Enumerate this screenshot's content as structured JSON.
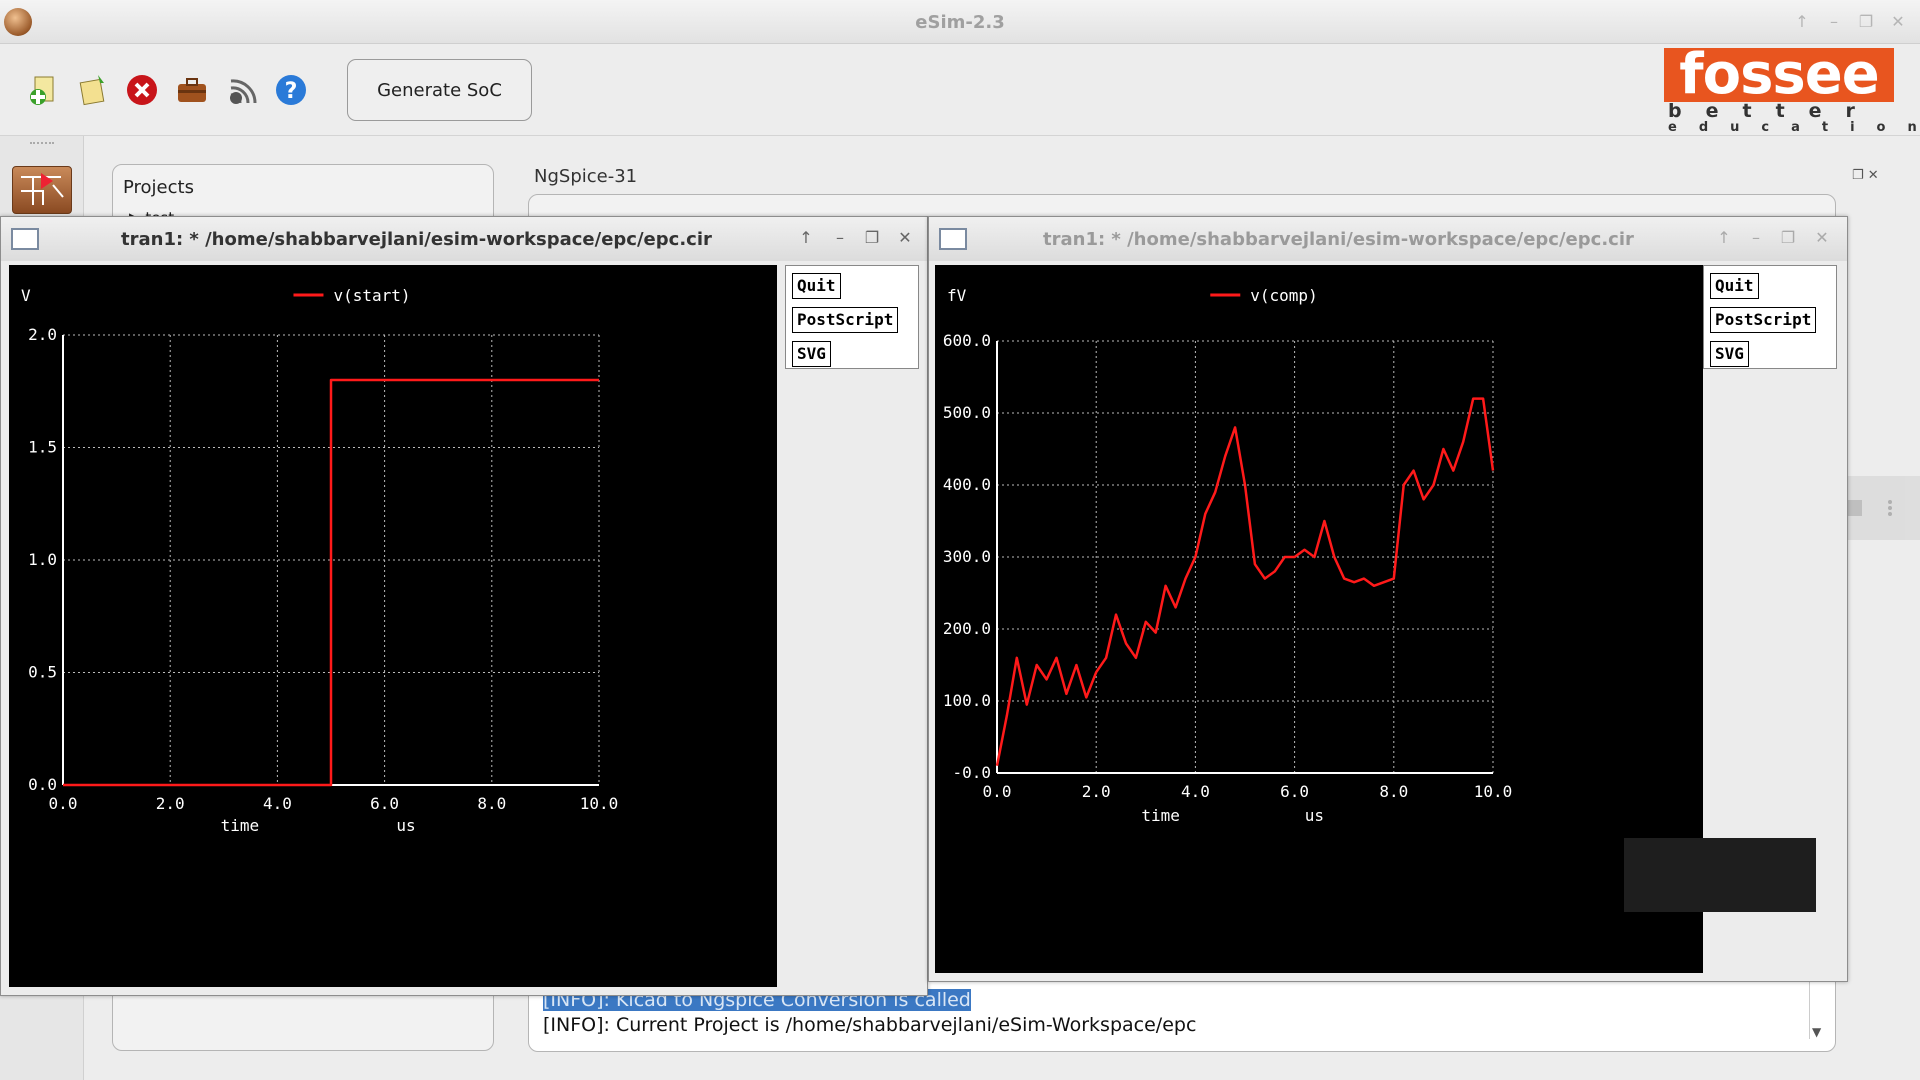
{
  "window": {
    "title": "eSim-2.3",
    "controls": [
      "↑",
      "–",
      "❐",
      "✕"
    ]
  },
  "toolbar": {
    "buttons": [
      {
        "name": "new-project",
        "icon": "new-project-icon"
      },
      {
        "name": "open-project",
        "icon": "open-project-icon"
      },
      {
        "name": "close-project",
        "icon": "close-icon"
      },
      {
        "name": "toolbox",
        "icon": "briefcase-icon"
      },
      {
        "name": "wifi",
        "icon": "wifi-icon"
      },
      {
        "name": "help",
        "icon": "help-icon"
      }
    ],
    "generate_soc_label": "Generate SoC",
    "logo": {
      "line1": "fossee",
      "line2": "better",
      "line3": "education"
    }
  },
  "projects_panel": {
    "title": "Projects",
    "tree_item": "test"
  },
  "ngspice": {
    "title": "NgSpice-31"
  },
  "console": {
    "lines": [
      "[INFO]: Kicad to Ngspice Conversion is called",
      "[INFO]: Current Project is /home/shabbarvejlani/eSim-Workspace/epc"
    ]
  },
  "plot_windows": [
    {
      "title": "tran1: * /home/shabbarvejlani/esim-workspace/epc/epc.cir",
      "active": true,
      "buttons": {
        "quit": "Quit",
        "postscript": "PostScript",
        "svg": "SVG"
      },
      "chart_data": {
        "type": "line",
        "ylabel_unit": "V",
        "xlabel": "time",
        "xunit": "us",
        "xlim": [
          0,
          10
        ],
        "ylim": [
          0,
          2
        ],
        "x_ticks": [
          "0.0",
          "2.0",
          "4.0",
          "6.0",
          "8.0",
          "10.0"
        ],
        "y_ticks": [
          "0.0",
          "0.5",
          "1.0",
          "1.5",
          "2.0"
        ],
        "series": [
          {
            "name": "v(start)",
            "color": "#ff1a1a",
            "x": [
              0,
              5,
              5,
              10
            ],
            "y": [
              0,
              0,
              1.8,
              1.8
            ]
          }
        ],
        "background": "#000000",
        "grid": true
      }
    },
    {
      "title": "tran1: * /home/shabbarvejlani/esim-workspace/epc/epc.cir",
      "active": false,
      "buttons": {
        "quit": "Quit",
        "postscript": "PostScript",
        "svg": "SVG"
      },
      "chart_data": {
        "type": "line",
        "ylabel_unit": "fV",
        "xlabel": "time",
        "xunit": "us",
        "xlim": [
          0,
          10
        ],
        "ylim": [
          0,
          600
        ],
        "x_ticks": [
          "0.0",
          "2.0",
          "4.0",
          "6.0",
          "8.0",
          "10.0"
        ],
        "y_ticks": [
          "-0.0",
          "100.0",
          "200.0",
          "300.0",
          "400.0",
          "500.0",
          "600.0"
        ],
        "series": [
          {
            "name": "v(comp)",
            "color": "#ff1a1a",
            "x": [
              0,
              0.2,
              0.4,
              0.6,
              0.8,
              1.0,
              1.2,
              1.4,
              1.6,
              1.8,
              2.0,
              2.2,
              2.4,
              2.6,
              2.8,
              3.0,
              3.2,
              3.4,
              3.6,
              3.8,
              4.0,
              4.2,
              4.4,
              4.6,
              4.8,
              5.0,
              5.2,
              5.4,
              5.6,
              5.8,
              6.0,
              6.2,
              6.4,
              6.6,
              6.8,
              7.0,
              7.2,
              7.4,
              7.6,
              7.8,
              8.0,
              8.2,
              8.4,
              8.6,
              8.8,
              9.0,
              9.2,
              9.4,
              9.6,
              9.8,
              10.0
            ],
            "y": [
              10,
              80,
              160,
              95,
              150,
              130,
              160,
              110,
              150,
              105,
              140,
              160,
              220,
              180,
              160,
              210,
              195,
              260,
              230,
              270,
              300,
              360,
              390,
              440,
              480,
              400,
              290,
              270,
              280,
              300,
              300,
              310,
              300,
              350,
              300,
              270,
              265,
              270,
              260,
              265,
              270,
              400,
              420,
              380,
              400,
              450,
              420,
              460,
              520,
              520,
              420
            ]
          }
        ],
        "background": "#000000",
        "grid": true
      }
    }
  ]
}
